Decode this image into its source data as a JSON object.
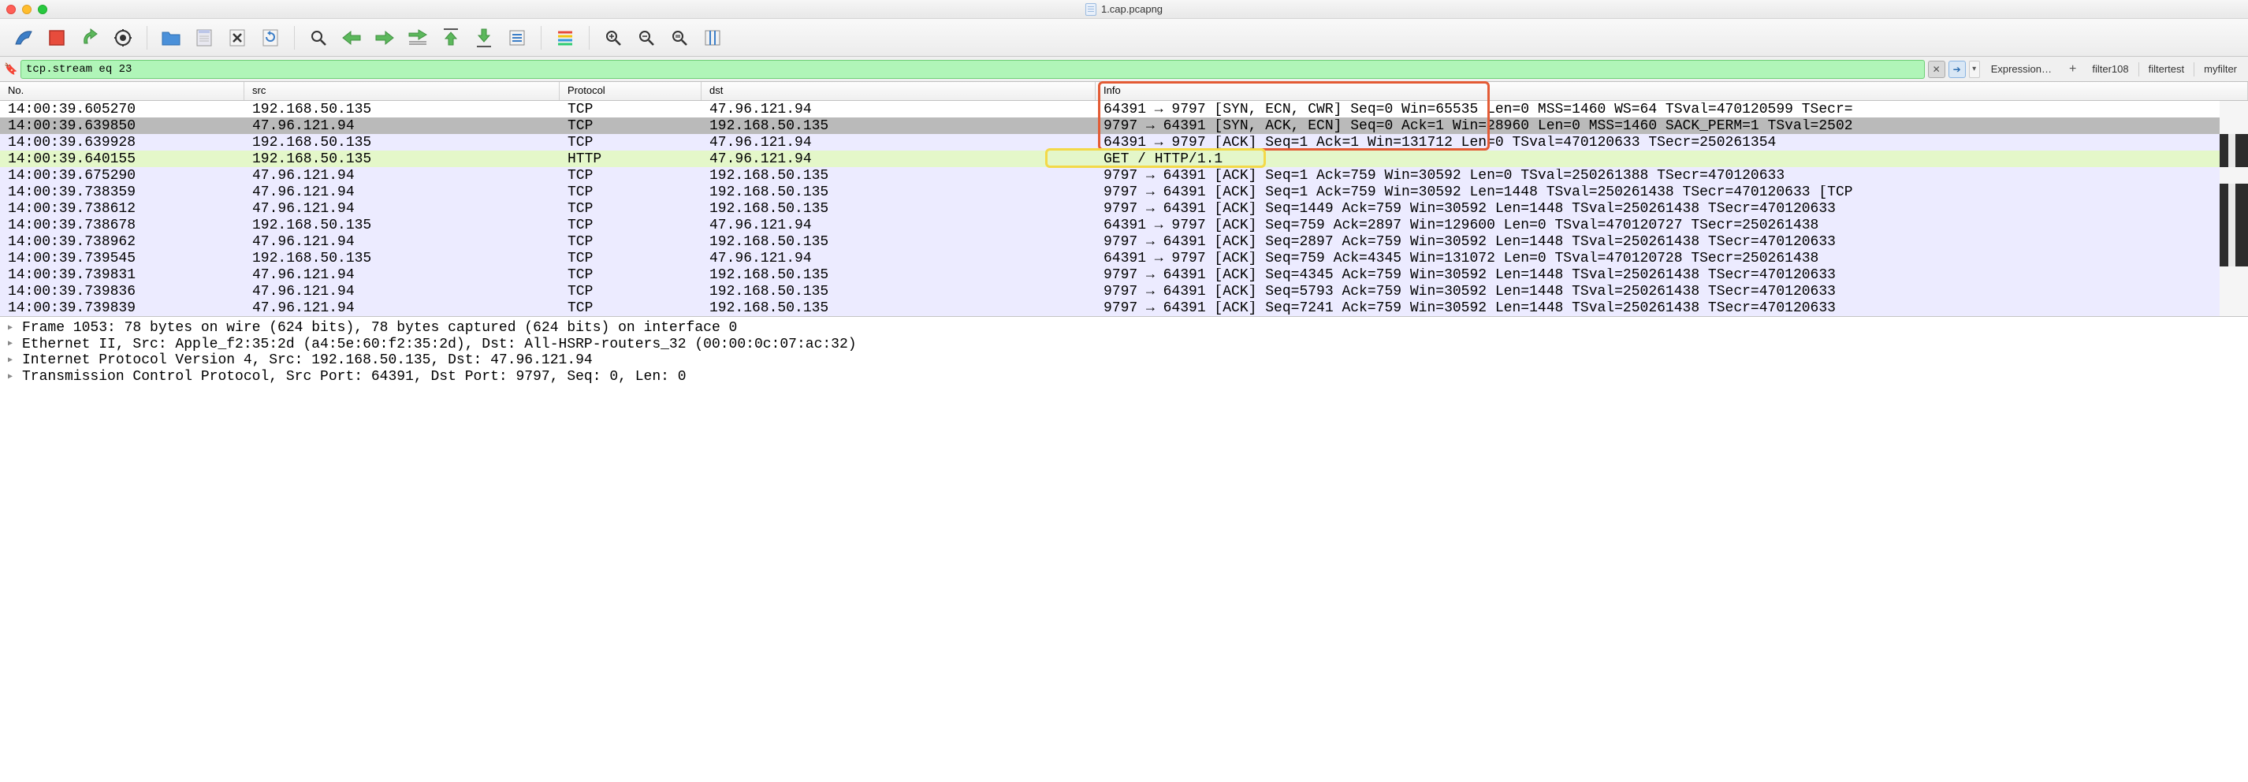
{
  "window": {
    "filename": "1.cap.pcapng"
  },
  "filter": {
    "value": "tcp.stream eq 23"
  },
  "filterbar": {
    "expression_label": "Expression…",
    "mini1": "filter108",
    "mini2": "filtertest",
    "mini3": "myfilter"
  },
  "columns": {
    "no": "No.",
    "src": "src",
    "proto": "Protocol",
    "dst": "dst",
    "info": "Info"
  },
  "packets": [
    {
      "no": "  14:00:39.605270",
      "src": "192.168.50.135",
      "proto": "TCP",
      "dst": "47.96.121.94",
      "info": "64391 → 9797 [SYN, ECN, CWR] Seq=0 Win=65535 Len=0 MSS=1460 WS=64 TSval=470120599 TSecr=",
      "bg": "bg-white",
      "selected": false
    },
    {
      "no": "  14:00:39.639850",
      "src": "47.96.121.94",
      "proto": "TCP",
      "dst": "192.168.50.135",
      "info": "9797 → 64391 [SYN, ACK, ECN] Seq=0 Ack=1 Win=28960 Len=0 MSS=1460 SACK_PERM=1 TSval=2502",
      "bg": "bg-selected",
      "selected": true
    },
    {
      "no": "  14:00:39.639928",
      "src": "192.168.50.135",
      "proto": "TCP",
      "dst": "47.96.121.94",
      "info": "64391 → 9797 [ACK] Seq=1 Ack=1 Win=131712 Len=0 TSval=470120633 TSecr=250261354",
      "bg": "bg-light-violet",
      "selected": false
    },
    {
      "no": "  14:00:39.640155",
      "src": "192.168.50.135",
      "proto": "HTTP",
      "dst": "47.96.121.94",
      "info": "GET / HTTP/1.1",
      "bg": "bg-http",
      "selected": false
    },
    {
      "no": "  14:00:39.675290",
      "src": "47.96.121.94",
      "proto": "TCP",
      "dst": "192.168.50.135",
      "info": "9797 → 64391 [ACK] Seq=1 Ack=759 Win=30592 Len=0 TSval=250261388 TSecr=470120633",
      "bg": "bg-light-violet",
      "selected": false
    },
    {
      "no": "  14:00:39.738359",
      "src": "47.96.121.94",
      "proto": "TCP",
      "dst": "192.168.50.135",
      "info": "9797 → 64391 [ACK] Seq=1 Ack=759 Win=30592 Len=1448 TSval=250261438 TSecr=470120633 [TCP",
      "bg": "bg-light-violet",
      "selected": false
    },
    {
      "no": "  14:00:39.738612",
      "src": "47.96.121.94",
      "proto": "TCP",
      "dst": "192.168.50.135",
      "info": "9797 → 64391 [ACK] Seq=1449 Ack=759 Win=30592 Len=1448 TSval=250261438 TSecr=470120633 ",
      "bg": "bg-light-violet",
      "selected": false
    },
    {
      "no": "  14:00:39.738678",
      "src": "192.168.50.135",
      "proto": "TCP",
      "dst": "47.96.121.94",
      "info": "64391 → 9797 [ACK] Seq=759 Ack=2897 Win=129600 Len=0 TSval=470120727 TSecr=250261438",
      "bg": "bg-light-violet",
      "selected": false
    },
    {
      "no": "  14:00:39.738962",
      "src": "47.96.121.94",
      "proto": "TCP",
      "dst": "192.168.50.135",
      "info": "9797 → 64391 [ACK] Seq=2897 Ack=759 Win=30592 Len=1448 TSval=250261438 TSecr=470120633 ",
      "bg": "bg-light-violet",
      "selected": false
    },
    {
      "no": "  14:00:39.739545",
      "src": "192.168.50.135",
      "proto": "TCP",
      "dst": "47.96.121.94",
      "info": "64391 → 9797 [ACK] Seq=759 Ack=4345 Win=131072 Len=0 TSval=470120728 TSecr=250261438",
      "bg": "bg-light-violet",
      "selected": false
    },
    {
      "no": "  14:00:39.739831",
      "src": "47.96.121.94",
      "proto": "TCP",
      "dst": "192.168.50.135",
      "info": "9797 → 64391 [ACK] Seq=4345 Ack=759 Win=30592 Len=1448 TSval=250261438 TSecr=470120633 ",
      "bg": "bg-light-violet",
      "selected": false
    },
    {
      "no": "  14:00:39.739836",
      "src": "47.96.121.94",
      "proto": "TCP",
      "dst": "192.168.50.135",
      "info": "9797 → 64391 [ACK] Seq=5793 Ack=759 Win=30592 Len=1448 TSval=250261438 TSecr=470120633 ",
      "bg": "bg-light-violet",
      "selected": false
    },
    {
      "no": "  14:00:39.739839",
      "src": "47.96.121.94",
      "proto": "TCP",
      "dst": "192.168.50.135",
      "info": "9797 → 64391 [ACK] Seq=7241 Ack=759 Win=30592 Len=1448 TSval=250261438 TSecr=470120633 ",
      "bg": "bg-light-violet",
      "selected": false
    }
  ],
  "details": {
    "frame": "Frame 1053: 78 bytes on wire (624 bits), 78 bytes captured (624 bits) on interface 0",
    "ethernet": "Ethernet II, Src: Apple_f2:35:2d (a4:5e:60:f2:35:2d), Dst: All-HSRP-routers_32 (00:00:0c:07:ac:32)",
    "ip": "Internet Protocol Version 4, Src: 192.168.50.135, Dst: 47.96.121.94",
    "tcp": "Transmission Control Protocol, Src Port: 64391, Dst Port: 9797, Seq: 0, Len: 0"
  }
}
